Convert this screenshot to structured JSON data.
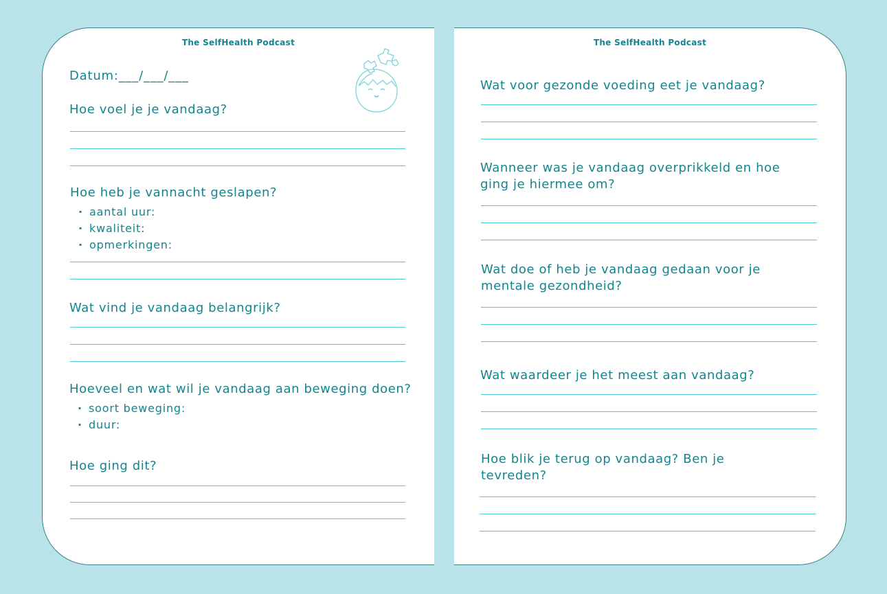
{
  "header": "The SelfHealth Podcast",
  "left": {
    "date_label": "Datum:___/___/___",
    "q_feel": "Hoe voel je je vandaag?",
    "q_sleep": "Hoe heb je vannacht geslapen?",
    "sleep_items": [
      "aantal uur:",
      "kwaliteit:",
      "opmerkingen:"
    ],
    "q_important": "Wat vind je vandaag belangrijk?",
    "q_movement": "Hoeveel en wat wil je vandaag aan beweging doen?",
    "movement_items": [
      "soort beweging:",
      "duur:"
    ],
    "q_how": "Hoe ging dit?"
  },
  "right": {
    "q_food": "Wat voor gezonde voeding eet je vandaag?",
    "q_overstim": "Wanneer was je vandaag overprikkeld en hoe ging je hiermee om?",
    "q_mental": "Wat doe of heb je vandaag gedaan voor je mentale gezondheid?",
    "q_appreciate": "Wat waardeer je het meest aan vandaag?",
    "q_lookback": "Hoe blik je terug op vandaag? Ben je tevreden?"
  },
  "colors": {
    "background": "#b8e3e8",
    "text": "#12858f",
    "lines": "#4ec6cf"
  },
  "icons": [
    "puzzle-egg-icon"
  ]
}
